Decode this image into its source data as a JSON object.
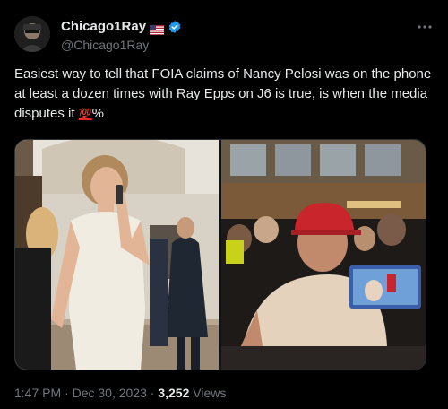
{
  "user": {
    "display_name": "Chicago1Ray",
    "handle": "@Chicago1Ray",
    "flag_icon": "us-flag-icon",
    "verified_icon": "verified-badge-icon",
    "verified_color": "#1d9bf0"
  },
  "tweet": {
    "text": "Easiest way to tell that FOIA claims of Nancy Pelosi was on the phone at least a dozen times with Ray Epps on J6 is true, is when the media disputes it",
    "emoji": "💯",
    "emoji_tail": "%"
  },
  "meta": {
    "time": "1:47 PM",
    "separator": "·",
    "date": "Dec 30, 2023",
    "views_count": "3,252",
    "views_label": "Views"
  },
  "colors": {
    "background": "#000000",
    "text": "#e7e9ea",
    "secondary": "#71767b",
    "accent": "#1d9bf0",
    "hat_red": "#c8262c"
  }
}
